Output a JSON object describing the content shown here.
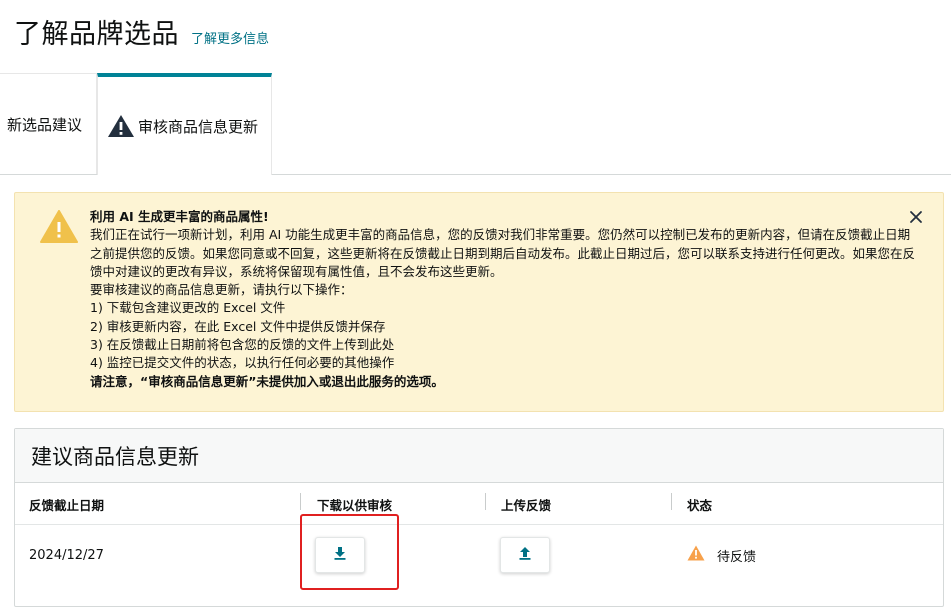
{
  "header": {
    "title": "了解品牌选品",
    "learn_more": "了解更多信息"
  },
  "tabs": [
    {
      "label": "新选品建议",
      "active": false
    },
    {
      "label": "审核商品信息更新",
      "active": true,
      "icon": "warning-icon"
    }
  ],
  "alert": {
    "title": "利用 AI 生成更丰富的商品属性!",
    "paragraph": "我们正在试行一项新计划，利用 AI 功能生成更丰富的商品信息，您的反馈对我们非常重要。您仍然可以控制已发布的更新内容，但请在反馈截止日期之前提供您的反馈。如果您同意或不回复，这些更新将在反馈截止日期到期后自动发布。此截止日期过后，您可以联系支持进行任何更改。如果您在反馈中对建议的更改有异议，系统将保留现有属性值，且不会发布这些更新。",
    "instructions": "要审核建议的商品信息更新，请执行以下操作：",
    "steps": [
      "1) 下载包含建议更改的 Excel 文件",
      "2) 审核更新内容，在此 Excel 文件中提供反馈并保存",
      "3) 在反馈截止日期前将包含您的反馈的文件上传到此处",
      "4) 监控已提交文件的状态，以执行任何必要的其他操作"
    ],
    "note": "请注意，“审核商品信息更新”未提供加入或退出此服务的选项。",
    "close_icon": "close-icon",
    "color_bg": "#fdf4d4",
    "color_icon": "#f0c14b"
  },
  "panel": {
    "title": "建议商品信息更新",
    "columns": [
      "反馈截止日期",
      "下载以供审核",
      "上传反馈",
      "状态"
    ],
    "rows": [
      {
        "deadline": "2024/12/27",
        "download_icon": "download-icon",
        "upload_icon": "upload-icon",
        "status": "待反馈",
        "status_icon": "warning-icon",
        "status_color": "#f7a14b"
      }
    ]
  },
  "colors": {
    "accent": "#008296",
    "link": "#007185",
    "highlight": "#e02020"
  }
}
